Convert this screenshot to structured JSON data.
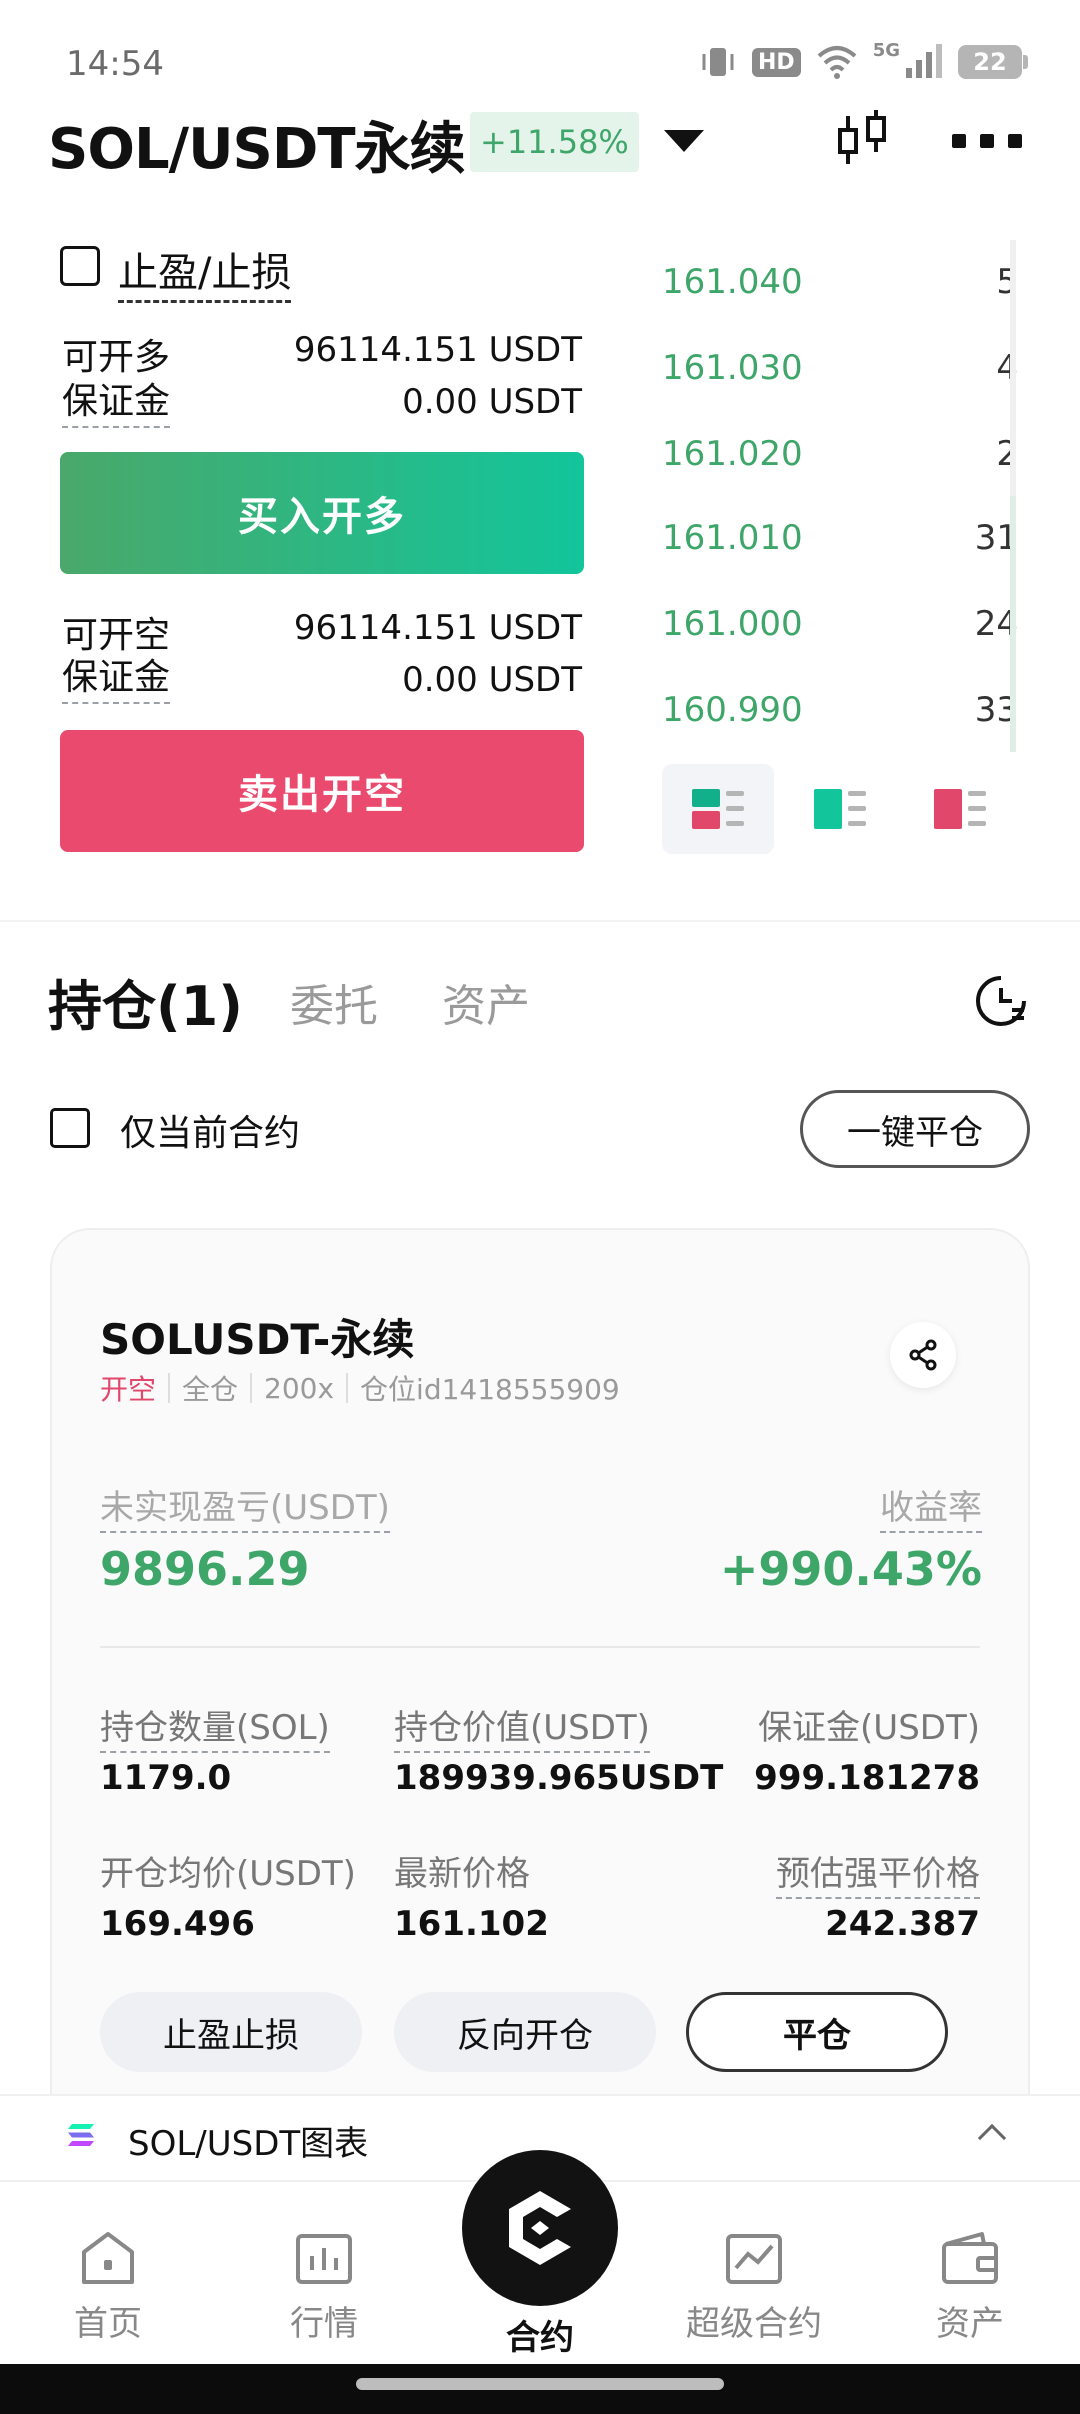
{
  "status_bar": {
    "time": "14:54",
    "hd": "HD",
    "network": "5G",
    "battery": "22"
  },
  "header": {
    "pair": "SOL/USDT永续",
    "change": "+11.58%"
  },
  "trade": {
    "tpsl_label": "止盈/止损",
    "long_avail_label": "可开多",
    "long_avail_value": "96114.151 USDT",
    "long_margin_label": "保证金",
    "long_margin_value": "0.00 USDT",
    "buy_label": "买入开多",
    "short_avail_label": "可开空",
    "short_avail_value": "96114.151 USDT",
    "short_margin_label": "保证金",
    "short_margin_value": "0.00 USDT",
    "sell_label": "卖出开空"
  },
  "orderbook": {
    "rows": [
      {
        "price": "161.040",
        "qty": "5"
      },
      {
        "price": "161.030",
        "qty": "4"
      },
      {
        "price": "161.020",
        "qty": "2"
      },
      {
        "price": "161.010",
        "qty": "31"
      },
      {
        "price": "161.000",
        "qty": "24"
      },
      {
        "price": "160.990",
        "qty": "33"
      }
    ]
  },
  "tabs": {
    "positions": "持仓(1)",
    "orders": "委托",
    "assets": "资产"
  },
  "filter": {
    "current_only": "仅当前合约",
    "close_all": "一键平仓"
  },
  "position": {
    "symbol": "SOLUSDT-永续",
    "side": "开空",
    "mode": "全仓",
    "leverage": "200x",
    "id": "仓位id1418555909",
    "pnl_label": "未实现盈亏(USDT)",
    "pnl_value": "9896.29",
    "roi_label": "收益率",
    "roi_value": "+990.43%",
    "size_label": "持仓数量(SOL)",
    "size_value": "1179.0",
    "value_label": "持仓价值(USDT)",
    "value_value": "189939.965USDT",
    "margin_label": "保证金(USDT)",
    "margin_value": "999.181278",
    "entry_label": "开仓均价(USDT)",
    "entry_value": "169.496",
    "last_label": "最新价格",
    "last_value": "161.102",
    "liq_label": "预估强平价格",
    "liq_value": "242.387",
    "tpsl_button": "止盈止损",
    "reverse_button": "反向开仓",
    "close_button": "平仓"
  },
  "chart_strip": {
    "label": "SOL/USDT图表"
  },
  "nav": {
    "home": "首页",
    "market": "行情",
    "contract": "合约",
    "super": "超级合约",
    "assets": "资产"
  },
  "colors": {
    "green": "#3fa66a",
    "red": "#e0476a",
    "buy_gradient_start": "#4aa86a",
    "buy_gradient_end": "#12c59b",
    "sell": "#ea4a6e"
  }
}
